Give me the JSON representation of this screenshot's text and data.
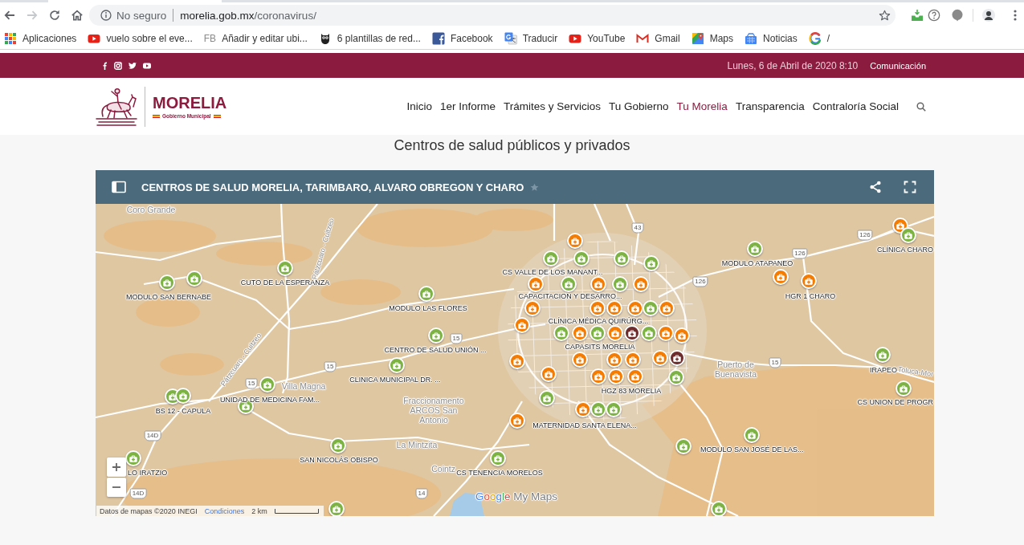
{
  "browser": {
    "nav_buttons": [
      {
        "kind": "back",
        "disabled": false
      },
      {
        "kind": "forward",
        "disabled": true
      },
      {
        "kind": "reload",
        "disabled": false
      },
      {
        "kind": "home",
        "disabled": false
      }
    ],
    "security": "No seguro",
    "url": "morelia.gob.mx/coronavirus/",
    "bookmarks": [
      {
        "kind": "apps",
        "label": "Aplicaciones"
      },
      {
        "kind": "video",
        "label": "vuelo sobre el eve..."
      },
      {
        "kind": "text",
        "badge": "FB",
        "label": "Añadir y editar ubi..."
      },
      {
        "kind": "owl",
        "label": "6 plantillas de red..."
      },
      {
        "kind": "facebook",
        "label": "Facebook"
      },
      {
        "kind": "translate",
        "label": "Traducir"
      },
      {
        "kind": "video",
        "label": "YouTube"
      },
      {
        "kind": "mail",
        "label": "Gmail"
      },
      {
        "kind": "maps",
        "label": "Maps"
      },
      {
        "kind": "news",
        "label": "Noticias"
      },
      {
        "kind": "google",
        "label": "/"
      }
    ]
  },
  "top_bar": {
    "date": "Lunes, 6 de Abril de 2020 8:10",
    "link": "Comunicación"
  },
  "header": {
    "logo": {
      "name": "MORELIA",
      "subtitle": "Gobierno Municipal"
    },
    "nav": [
      {
        "label": "Inicio",
        "selected": false
      },
      {
        "label": "1er Informe",
        "selected": false
      },
      {
        "label": "Trámites y Servicios",
        "selected": false
      },
      {
        "label": "Tu Gobierno",
        "selected": false
      },
      {
        "label": "Tu Morelia",
        "selected": true
      },
      {
        "label": "Transparencia",
        "selected": false
      },
      {
        "label": "Contraloría Social",
        "selected": false
      }
    ]
  },
  "heading": "Centros de salud públicos y privados",
  "map": {
    "title": "CENTROS DE SALUD MORELIA, TARIMBARO, ALVARO OBREGON Y CHARO",
    "markers": [
      {
        "color": "#f57c00"
      },
      {
        "color": "#7cb342",
        "label": "CLÍNICA CHARO"
      },
      {
        "color": "#f57c00"
      },
      {
        "color": "#7cb342",
        "label": "MODULO ATAPANEO"
      },
      {
        "color": "#7cb342",
        "label": "CS VALLE DE LOS MANANT..."
      },
      {
        "color": "#7cb342"
      },
      {
        "color": "#7cb342"
      },
      {
        "color": "#7cb342"
      },
      {
        "color": "#7cb342",
        "label": "CUTO DE LA ESPERANZA"
      },
      {
        "color": "#7cb342",
        "label": "MODULO SAN BERNABE"
      },
      {
        "color": "#7cb342"
      },
      {
        "color": "#f57c00"
      },
      {
        "color": "#7cb342",
        "label": "CAPACITACION Y DESARRO..."
      },
      {
        "color": "#f57c00"
      },
      {
        "color": "#7cb342"
      },
      {
        "color": "#f57c00"
      },
      {
        "color": "#f57c00"
      },
      {
        "color": "#f57c00",
        "label": "HGR 1 CHARO"
      },
      {
        "color": "#7cb342",
        "label": "MODULO LAS FLORES"
      },
      {
        "color": "#f57c00"
      },
      {
        "color": "#f57c00",
        "label": "CLÍNICA MÉDICA QUIRÚRG..."
      },
      {
        "color": "#f57c00"
      },
      {
        "color": "#f57c00"
      },
      {
        "color": "#7cb342"
      },
      {
        "color": "#f57c00"
      },
      {
        "color": "#f57c00"
      },
      {
        "color": "#7cb342",
        "label": "CENTRO DE SALUD UNIÓN ..."
      },
      {
        "color": "#7cb342"
      },
      {
        "color": "#f57c00"
      },
      {
        "color": "#7cb342",
        "label": "CAPASITS MORELIA"
      },
      {
        "color": "#f57c00"
      },
      {
        "color": "#6e2b2b"
      },
      {
        "color": "#7cb342"
      },
      {
        "color": "#f57c00"
      },
      {
        "color": "#f57c00"
      },
      {
        "color": "#7cb342",
        "label": "IRAPEO"
      },
      {
        "color": "#7cb342",
        "label": "CLINICA MUNICIPAL DR. ..."
      },
      {
        "color": "#f57c00"
      },
      {
        "color": "#f57c00"
      },
      {
        "color": "#f57c00"
      },
      {
        "color": "#f57c00"
      },
      {
        "color": "#f57c00"
      },
      {
        "color": "#6e2b2b"
      },
      {
        "color": "#f57c00"
      },
      {
        "color": "#f57c00"
      },
      {
        "color": "#f57c00"
      },
      {
        "color": "#f57c00",
        "label": "HGZ 83 MORELIA"
      },
      {
        "color": "#7cb342"
      },
      {
        "color": "#7cb342",
        "label": "UNIDAD DE MEDICINA FAM..."
      },
      {
        "color": "#7cb342",
        "label": "CS UNION DE PROGR"
      },
      {
        "color": "#7cb342",
        "label": "BS 12 - CAPULA"
      },
      {
        "color": "#7cb342"
      },
      {
        "color": "#7cb342"
      },
      {
        "color": "#7cb342"
      },
      {
        "color": "#f57c00",
        "label": "MATERNIDAD SANTA ELENA..."
      },
      {
        "color": "#7cb342"
      },
      {
        "color": "#7cb342"
      },
      {
        "color": "#f57c00"
      },
      {
        "color": "#7cb342"
      },
      {
        "color": "#7cb342",
        "label": "MODULO SAN JOSÉ DE LAS..."
      },
      {
        "color": "#7cb342",
        "label": "SAN NICOLÁS OBISPO"
      },
      {
        "color": "#7cb342",
        "label": "LO IRATZIO"
      },
      {
        "color": "#7cb342",
        "label": "CS TENENCIA MORELOS"
      },
      {
        "color": "#7cb342"
      },
      {
        "color": "#7cb342"
      }
    ],
    "places": [
      "Coro Grande",
      "Puerto de Buenavista",
      "Villa Magna",
      "Fraccionamento ARCOS San Antonio",
      "La Mintzita",
      "Cointz"
    ],
    "roads": [
      "Pátzcuaro - Cuitzeo",
      "Pátzcuaro - Cuitzeo",
      "Toluca-Mor"
    ],
    "shields": [
      "43",
      "126",
      "126",
      "126",
      "15",
      "15",
      "15",
      "15",
      "14D",
      "14D",
      "14"
    ],
    "attribution": "Datos de mapas ©2020 INEGI",
    "terms": "Condiciones",
    "scale": "2 km",
    "logo": {
      "brand": "Google",
      "product": "My Maps"
    }
  }
}
